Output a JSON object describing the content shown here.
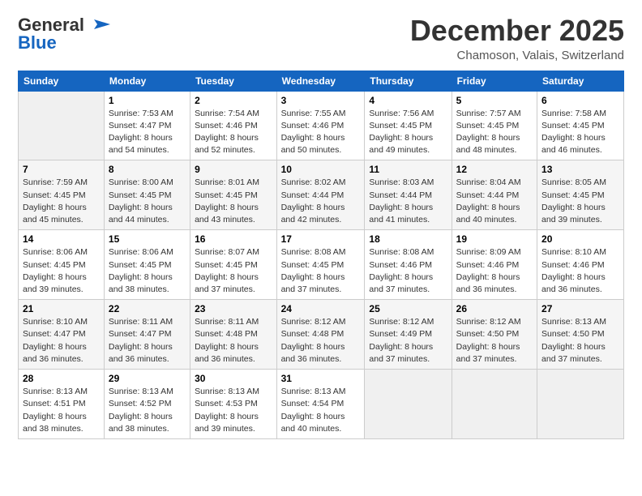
{
  "logo": {
    "line1": "General",
    "line2": "Blue"
  },
  "header": {
    "month": "December 2025",
    "location": "Chamoson, Valais, Switzerland"
  },
  "weekdays": [
    "Sunday",
    "Monday",
    "Tuesday",
    "Wednesday",
    "Thursday",
    "Friday",
    "Saturday"
  ],
  "weeks": [
    [
      {
        "day": "",
        "info": ""
      },
      {
        "day": "1",
        "info": "Sunrise: 7:53 AM\nSunset: 4:47 PM\nDaylight: 8 hours\nand 54 minutes."
      },
      {
        "day": "2",
        "info": "Sunrise: 7:54 AM\nSunset: 4:46 PM\nDaylight: 8 hours\nand 52 minutes."
      },
      {
        "day": "3",
        "info": "Sunrise: 7:55 AM\nSunset: 4:46 PM\nDaylight: 8 hours\nand 50 minutes."
      },
      {
        "day": "4",
        "info": "Sunrise: 7:56 AM\nSunset: 4:45 PM\nDaylight: 8 hours\nand 49 minutes."
      },
      {
        "day": "5",
        "info": "Sunrise: 7:57 AM\nSunset: 4:45 PM\nDaylight: 8 hours\nand 48 minutes."
      },
      {
        "day": "6",
        "info": "Sunrise: 7:58 AM\nSunset: 4:45 PM\nDaylight: 8 hours\nand 46 minutes."
      }
    ],
    [
      {
        "day": "7",
        "info": "Sunrise: 7:59 AM\nSunset: 4:45 PM\nDaylight: 8 hours\nand 45 minutes."
      },
      {
        "day": "8",
        "info": "Sunrise: 8:00 AM\nSunset: 4:45 PM\nDaylight: 8 hours\nand 44 minutes."
      },
      {
        "day": "9",
        "info": "Sunrise: 8:01 AM\nSunset: 4:45 PM\nDaylight: 8 hours\nand 43 minutes."
      },
      {
        "day": "10",
        "info": "Sunrise: 8:02 AM\nSunset: 4:44 PM\nDaylight: 8 hours\nand 42 minutes."
      },
      {
        "day": "11",
        "info": "Sunrise: 8:03 AM\nSunset: 4:44 PM\nDaylight: 8 hours\nand 41 minutes."
      },
      {
        "day": "12",
        "info": "Sunrise: 8:04 AM\nSunset: 4:44 PM\nDaylight: 8 hours\nand 40 minutes."
      },
      {
        "day": "13",
        "info": "Sunrise: 8:05 AM\nSunset: 4:45 PM\nDaylight: 8 hours\nand 39 minutes."
      }
    ],
    [
      {
        "day": "14",
        "info": "Sunrise: 8:06 AM\nSunset: 4:45 PM\nDaylight: 8 hours\nand 39 minutes."
      },
      {
        "day": "15",
        "info": "Sunrise: 8:06 AM\nSunset: 4:45 PM\nDaylight: 8 hours\nand 38 minutes."
      },
      {
        "day": "16",
        "info": "Sunrise: 8:07 AM\nSunset: 4:45 PM\nDaylight: 8 hours\nand 37 minutes."
      },
      {
        "day": "17",
        "info": "Sunrise: 8:08 AM\nSunset: 4:45 PM\nDaylight: 8 hours\nand 37 minutes."
      },
      {
        "day": "18",
        "info": "Sunrise: 8:08 AM\nSunset: 4:46 PM\nDaylight: 8 hours\nand 37 minutes."
      },
      {
        "day": "19",
        "info": "Sunrise: 8:09 AM\nSunset: 4:46 PM\nDaylight: 8 hours\nand 36 minutes."
      },
      {
        "day": "20",
        "info": "Sunrise: 8:10 AM\nSunset: 4:46 PM\nDaylight: 8 hours\nand 36 minutes."
      }
    ],
    [
      {
        "day": "21",
        "info": "Sunrise: 8:10 AM\nSunset: 4:47 PM\nDaylight: 8 hours\nand 36 minutes."
      },
      {
        "day": "22",
        "info": "Sunrise: 8:11 AM\nSunset: 4:47 PM\nDaylight: 8 hours\nand 36 minutes."
      },
      {
        "day": "23",
        "info": "Sunrise: 8:11 AM\nSunset: 4:48 PM\nDaylight: 8 hours\nand 36 minutes."
      },
      {
        "day": "24",
        "info": "Sunrise: 8:12 AM\nSunset: 4:48 PM\nDaylight: 8 hours\nand 36 minutes."
      },
      {
        "day": "25",
        "info": "Sunrise: 8:12 AM\nSunset: 4:49 PM\nDaylight: 8 hours\nand 37 minutes."
      },
      {
        "day": "26",
        "info": "Sunrise: 8:12 AM\nSunset: 4:50 PM\nDaylight: 8 hours\nand 37 minutes."
      },
      {
        "day": "27",
        "info": "Sunrise: 8:13 AM\nSunset: 4:50 PM\nDaylight: 8 hours\nand 37 minutes."
      }
    ],
    [
      {
        "day": "28",
        "info": "Sunrise: 8:13 AM\nSunset: 4:51 PM\nDaylight: 8 hours\nand 38 minutes."
      },
      {
        "day": "29",
        "info": "Sunrise: 8:13 AM\nSunset: 4:52 PM\nDaylight: 8 hours\nand 38 minutes."
      },
      {
        "day": "30",
        "info": "Sunrise: 8:13 AM\nSunset: 4:53 PM\nDaylight: 8 hours\nand 39 minutes."
      },
      {
        "day": "31",
        "info": "Sunrise: 8:13 AM\nSunset: 4:54 PM\nDaylight: 8 hours\nand 40 minutes."
      },
      {
        "day": "",
        "info": ""
      },
      {
        "day": "",
        "info": ""
      },
      {
        "day": "",
        "info": ""
      }
    ]
  ]
}
